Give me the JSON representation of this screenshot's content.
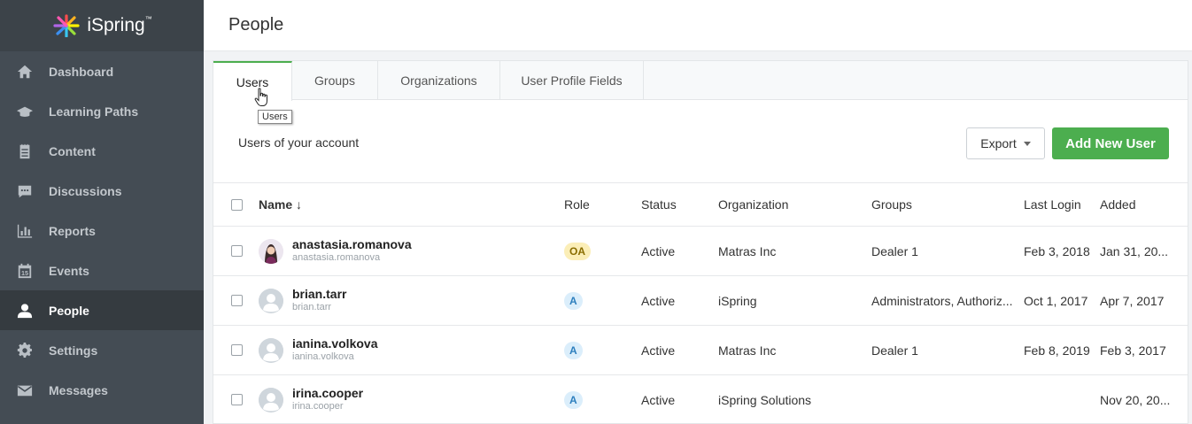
{
  "app": {
    "logo_text": "iSpring",
    "logo_mark": "™"
  },
  "sidebar": {
    "items": [
      {
        "label": "Dashboard",
        "icon": "home-icon"
      },
      {
        "label": "Learning Paths",
        "icon": "graduation-cap-icon"
      },
      {
        "label": "Content",
        "icon": "notebook-icon"
      },
      {
        "label": "Discussions",
        "icon": "chat-icon"
      },
      {
        "label": "Reports",
        "icon": "bar-chart-icon"
      },
      {
        "label": "Events",
        "icon": "calendar-icon"
      },
      {
        "label": "People",
        "icon": "person-icon",
        "active": true
      },
      {
        "label": "Settings",
        "icon": "gear-icon"
      },
      {
        "label": "Messages",
        "icon": "envelope-icon"
      }
    ]
  },
  "header": {
    "title": "People"
  },
  "tabs": [
    {
      "label": "Users",
      "active": true
    },
    {
      "label": "Groups"
    },
    {
      "label": "Organizations"
    },
    {
      "label": "User Profile Fields"
    }
  ],
  "tooltip": {
    "text": "Users"
  },
  "toolbar": {
    "subtitle": "Users of your account",
    "export_label": "Export",
    "add_label": "Add New User"
  },
  "table": {
    "headers": {
      "name": "Name ↓",
      "role": "Role",
      "status": "Status",
      "organization": "Organization",
      "groups": "Groups",
      "last_login": "Last Login",
      "added": "Added"
    },
    "rows": [
      {
        "name": "anastasia.romanova",
        "login": "anastasia.romanova",
        "role": "OA",
        "status": "Active",
        "organization": "Matras Inc",
        "groups": "Dealer 1",
        "last_login": "Feb 3, 2018",
        "added": "Jan 31, 20..."
      },
      {
        "name": "brian.tarr",
        "login": "brian.tarr",
        "role": "A",
        "status": "Active",
        "organization": "iSpring",
        "groups": "Administrators, Authoriz...",
        "last_login": "Oct 1, 2017",
        "added": "Apr 7, 2017"
      },
      {
        "name": "ianina.volkova",
        "login": "ianina.volkova",
        "role": "A",
        "status": "Active",
        "organization": "Matras Inc",
        "groups": "Dealer 1",
        "last_login": "Feb 8, 2019",
        "added": "Feb 3, 2017"
      },
      {
        "name": "irina.cooper",
        "login": "irina.cooper",
        "role": "A",
        "status": "Active",
        "organization": "iSpring Solutions",
        "groups": "",
        "last_login": "",
        "added": "Nov 20, 20..."
      }
    ]
  },
  "colors": {
    "sidebar": "#444c54",
    "accent": "#4cae4f"
  }
}
